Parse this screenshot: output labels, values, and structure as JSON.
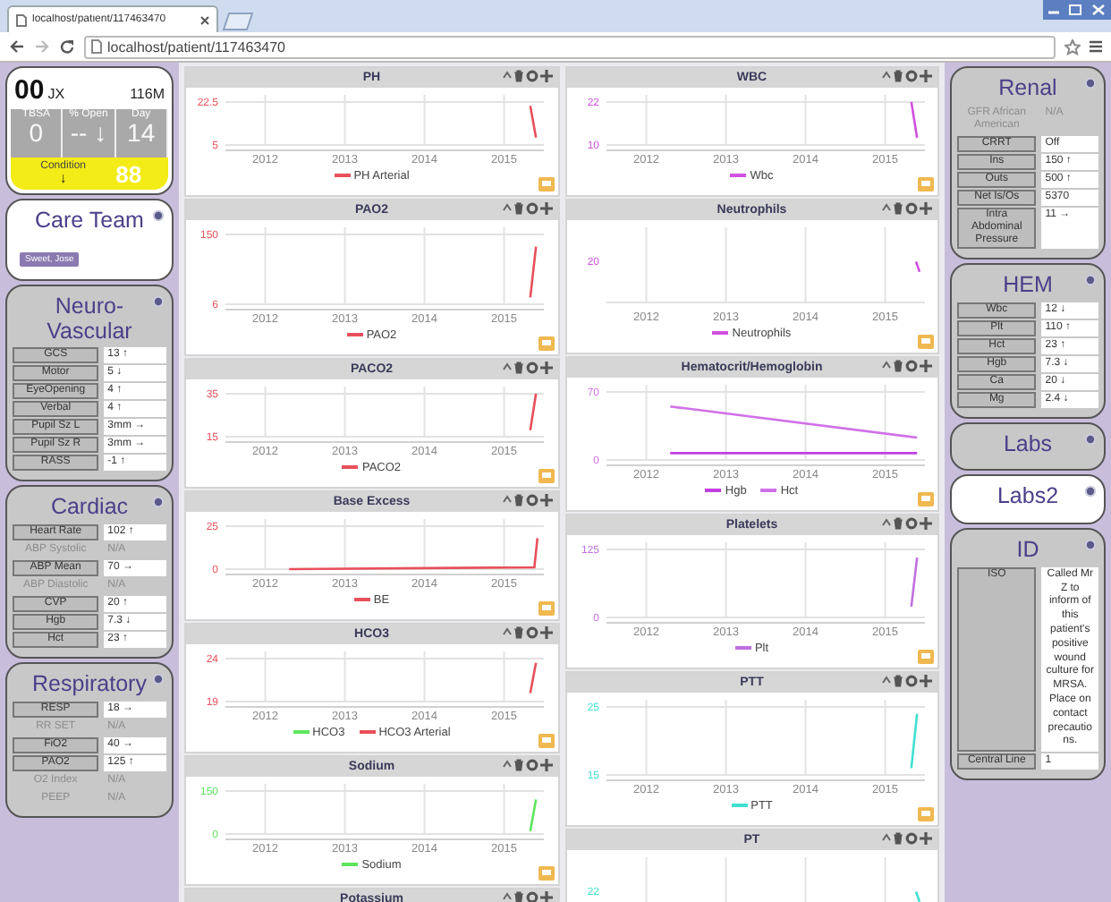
{
  "browser": {
    "tab_title": "localhost/patient/117463470",
    "url": "localhost/patient/117463470"
  },
  "left_cards": [
    {
      "kind": "summary",
      "bed": "00",
      "initials": "JX",
      "age_sex": "116M",
      "stats": [
        {
          "label": "TBSA",
          "value": "0"
        },
        {
          "label": "% Open",
          "value": "--",
          "arrow": "↓"
        },
        {
          "label": "Day",
          "value": "14"
        }
      ],
      "condition": {
        "label": "Condition",
        "arrow": "↓",
        "score": "88"
      }
    },
    {
      "kind": "team",
      "title": "Care Team",
      "selected": true,
      "members": [
        "Sweet, Jose"
      ]
    },
    {
      "kind": "table",
      "title": "Neuro-Vascular",
      "selected": false,
      "rows": [
        {
          "label": "GCS",
          "value": "13 ↑",
          "disabled": false
        },
        {
          "label": "Motor",
          "value": "5 ↓",
          "disabled": false
        },
        {
          "label": "EyeOpening",
          "value": "4 ↑",
          "disabled": false
        },
        {
          "label": "Verbal",
          "value": "4 ↑",
          "disabled": false
        },
        {
          "label": "Pupil Sz L",
          "value": "3mm →",
          "disabled": false
        },
        {
          "label": "Pupil Sz R",
          "value": "3mm →",
          "disabled": false
        },
        {
          "label": "RASS",
          "value": "-1 ↑",
          "disabled": false
        }
      ]
    },
    {
      "kind": "table",
      "title": "Cardiac",
      "selected": false,
      "rows": [
        {
          "label": "Heart Rate",
          "value": "102 ↑",
          "disabled": false
        },
        {
          "label": "ABP Systolic",
          "value": "N/A",
          "disabled": true
        },
        {
          "label": "ABP Mean",
          "value": "70 →",
          "disabled": false
        },
        {
          "label": "ABP Diastolic",
          "value": "N/A",
          "disabled": true
        },
        {
          "label": "CVP",
          "value": "20 ↑",
          "disabled": false
        },
        {
          "label": "Hgb",
          "value": "7.3 ↓",
          "disabled": false
        },
        {
          "label": "Hct",
          "value": "23 ↑",
          "disabled": false
        }
      ]
    },
    {
      "kind": "table",
      "title": "Respiratory",
      "selected": false,
      "rows": [
        {
          "label": "RESP",
          "value": "18 →",
          "disabled": false
        },
        {
          "label": "RR SET",
          "value": "N/A",
          "disabled": true
        },
        {
          "label": "FiO2",
          "value": "40 →",
          "disabled": false
        },
        {
          "label": "PAO2",
          "value": "125 ↑",
          "disabled": false
        },
        {
          "label": "O2 Index",
          "value": "N/A",
          "disabled": true
        },
        {
          "label": "PEEP",
          "value": "N/A",
          "disabled": true
        }
      ]
    }
  ],
  "chart_columns": [
    {
      "panels": [
        {
          "title": "PH",
          "chart_data": {
            "type": "line",
            "xlim": [
              2011.5,
              2015.5
            ],
            "grid": true,
            "x": [
              2015.33,
              2015.4
            ],
            "ylim": [
              5,
              22.5
            ],
            "xticks": [
              2012,
              2013,
              2014,
              2015
            ],
            "yticks": [
              5,
              22.5
            ],
            "series": [
              {
                "name": "PH Arterial",
                "color": "#e8505b",
                "values": [
                  21,
                  8
                ]
              }
            ]
          }
        },
        {
          "title": "PAO2",
          "chart_data": {
            "type": "line",
            "xlim": [
              2011.5,
              2015.5
            ],
            "grid": true,
            "x": [
              2015.33,
              2015.4
            ],
            "ylim": [
              6,
              150
            ],
            "xticks": [
              2012,
              2013,
              2014,
              2015
            ],
            "yticks": [
              6,
              150
            ],
            "series": [
              {
                "name": "PAO2",
                "color": "#e8505b",
                "values": [
                  20,
                  125
                ]
              }
            ]
          }
        },
        {
          "title": "PACO2",
          "chart_data": {
            "type": "line",
            "xlim": [
              2011.5,
              2015.5
            ],
            "grid": true,
            "x": [
              2015.33,
              2015.4
            ],
            "ylim": [
              15,
              35
            ],
            "xticks": [
              2012,
              2013,
              2014,
              2015
            ],
            "yticks": [
              15,
              35
            ],
            "series": [
              {
                "name": "PACO2",
                "color": "#e8505b",
                "values": [
                  18,
                  35
                ]
              }
            ]
          }
        },
        {
          "title": "Base Excess",
          "chart_data": {
            "type": "line",
            "xlim": [
              2011.5,
              2015.5
            ],
            "grid": true,
            "x": [
              2012.3,
              2015.38,
              2015.42
            ],
            "ylim": [
              0,
              25
            ],
            "xticks": [
              2012,
              2013,
              2014,
              2015
            ],
            "yticks": [
              0,
              25
            ],
            "series": [
              {
                "name": "BE",
                "color": "#e8505b",
                "values": [
                  0,
                  1,
                  18
                ]
              }
            ]
          }
        },
        {
          "title": "HCO3",
          "chart_data": {
            "type": "line",
            "xlim": [
              2011.5,
              2015.5
            ],
            "grid": true,
            "x": [
              2015.33,
              2015.4
            ],
            "ylim": [
              19,
              24
            ],
            "xticks": [
              2012,
              2013,
              2014,
              2015
            ],
            "yticks": [
              19,
              24
            ],
            "series": [
              {
                "name": "HCO3",
                "color": "#5ee65e",
                "values": [
                  null,
                  null
                ]
              },
              {
                "name": "HCO3 Arterial",
                "color": "#e8505b",
                "values": [
                  20,
                  23.5
                ]
              }
            ]
          }
        },
        {
          "title": "Sodium",
          "chart_data": {
            "type": "line",
            "xlim": [
              2011.5,
              2015.5
            ],
            "grid": true,
            "x": [
              2015.33,
              2015.4
            ],
            "ylim": [
              0,
              150
            ],
            "xticks": [
              2012,
              2013,
              2014,
              2015
            ],
            "yticks": [
              0,
              150
            ],
            "series": [
              {
                "name": "Sodium",
                "color": "#5ee65e",
                "values": [
                  10,
                  120
                ]
              }
            ]
          }
        },
        {
          "title": "Potassium"
        }
      ]
    },
    {
      "panels": [
        {
          "title": "WBC",
          "chart_data": {
            "type": "line",
            "xlim": [
              2011.5,
              2015.5
            ],
            "grid": true,
            "x": [
              2015.33,
              2015.4
            ],
            "ylim": [
              10,
              22
            ],
            "xticks": [
              2012,
              2013,
              2014,
              2015
            ],
            "yticks": [
              10,
              22
            ],
            "series": [
              {
                "name": "Wbc",
                "color": "#d050e0",
                "values": [
                  22,
                  12
                ]
              }
            ]
          }
        },
        {
          "title": "Neutrophils",
          "plot": {
            "y_labels": [
              "20"
            ],
            "x_labels": [
              "2012",
              "2013",
              "2014",
              "2015"
            ],
            "legend": [
              {
                "name": "Neutrophils",
                "color": "#d050e0"
              }
            ]
          }
        },
        {
          "title": "Hematocrit/Hemoglobin",
          "chart_data": {
            "type": "line",
            "xlim": [
              2011.5,
              2015.5
            ],
            "grid": true,
            "x": [
              2012.3,
              2015.4
            ],
            "ylim": [
              0,
              70
            ],
            "xticks": [
              2012,
              2013,
              2014,
              2015
            ],
            "yticks": [
              0,
              70
            ],
            "series": [
              {
                "name": "Hgb",
                "color": "#c040e0",
                "values": [
                  7,
                  7
                ]
              },
              {
                "name": "Hct",
                "color": "#d070e8",
                "values": [
                  55,
                  23
                ]
              }
            ]
          }
        },
        {
          "title": "Platelets",
          "chart_data": {
            "type": "line",
            "xlim": [
              2011.5,
              2015.5
            ],
            "grid": true,
            "x": [
              2015.33,
              2015.4
            ],
            "ylim": [
              0,
              125
            ],
            "xticks": [
              2012,
              2013,
              2014,
              2015
            ],
            "yticks": [
              0,
              125
            ],
            "series": [
              {
                "name": "Plt",
                "color": "#c070e0",
                "values": [
                  20,
                  110
                ]
              }
            ]
          }
        },
        {
          "title": "PTT",
          "chart_data": {
            "type": "line",
            "xlim": [
              2011.5,
              2015.5
            ],
            "grid": true,
            "x": [
              2015.33,
              2015.4
            ],
            "ylim": [
              15,
              25
            ],
            "xticks": [
              2012,
              2013,
              2014,
              2015
            ],
            "yticks": [
              15,
              25
            ],
            "series": [
              {
                "name": "PTT",
                "color": "#40e0d0",
                "values": [
                  16,
                  24
                ]
              }
            ]
          }
        },
        {
          "title": "PT",
          "plot": {
            "y_labels": [
              "22"
            ]
          }
        }
      ]
    }
  ],
  "right_cards": [
    {
      "kind": "table",
      "title": "Renal",
      "selected": false,
      "rows": [
        {
          "label": "GFR African American",
          "value": "N/A",
          "disabled": true
        },
        {
          "label": "CRRT",
          "value": "Off",
          "disabled": false
        },
        {
          "label": "Ins",
          "value": "150 ↑",
          "disabled": false
        },
        {
          "label": "Outs",
          "value": "500 ↑",
          "disabled": false
        },
        {
          "label": "Net Is/Os",
          "value": "5370",
          "disabled": false
        },
        {
          "label": "Intra Abdominal Pressure",
          "value": "11 →",
          "disabled": false
        }
      ]
    },
    {
      "kind": "table",
      "title": "HEM",
      "selected": false,
      "rows": [
        {
          "label": "Wbc",
          "value": "12 ↓",
          "disabled": false
        },
        {
          "label": "Plt",
          "value": "110 ↑",
          "disabled": false
        },
        {
          "label": "Hct",
          "value": "23 ↑",
          "disabled": false
        },
        {
          "label": "Hgb",
          "value": "7.3 ↓",
          "disabled": false
        },
        {
          "label": "Ca",
          "value": "20 ↓",
          "disabled": false
        },
        {
          "label": "Mg",
          "value": "2.4 ↓",
          "disabled": false
        }
      ]
    },
    {
      "kind": "table",
      "title": "Labs",
      "selected": false
    },
    {
      "kind": "table",
      "title": "Labs2",
      "selected": true
    },
    {
      "kind": "table",
      "title": "ID",
      "selected": false,
      "rows": [
        {
          "label": "ISO",
          "value": "Called Mr Z to inform of this patient's positive wound culture for MRSA. Place on contact precautions.",
          "disabled": false
        },
        {
          "label": "Central Line",
          "value": "1",
          "disabled": false
        }
      ]
    }
  ]
}
